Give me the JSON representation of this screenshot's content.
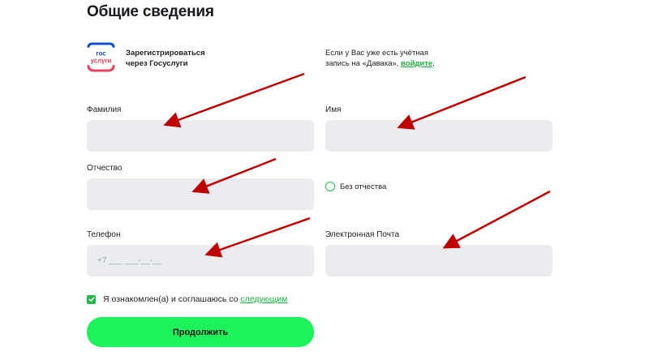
{
  "page": {
    "title": "Общие сведения"
  },
  "gosuslugi": {
    "logo_line1": "гос",
    "logo_line2": "услуги",
    "text_line1": "Зарегистрироваться",
    "text_line2": "через Госуслуги"
  },
  "login_note": {
    "line1": "Если у Вас уже есть учётная",
    "line2_before": "запись на «Давака»,",
    "link": "войдите",
    "line2_after": "."
  },
  "form": {
    "last_name_label": "Фамилия",
    "first_name_label": "Имя",
    "patronymic_label": "Отчество",
    "no_patronymic_label": "Без отчества",
    "phone_label": "Телефон",
    "phone_placeholder": "+7 ___ ___-__-__",
    "email_label": "Электронная Почта"
  },
  "agreement": {
    "text": "Я ознакомлен(а) и соглашаюсь со ",
    "link": "следующим",
    "checked": true
  },
  "submit_label": "Продолжить",
  "colors": {
    "accent_green": "#1cf259",
    "link_green": "#17b53c",
    "field_bg": "#eaecef",
    "annotation_arrow": "#c00000",
    "gos_blue": "#0d4cd3",
    "gos_red": "#ee3f58"
  }
}
